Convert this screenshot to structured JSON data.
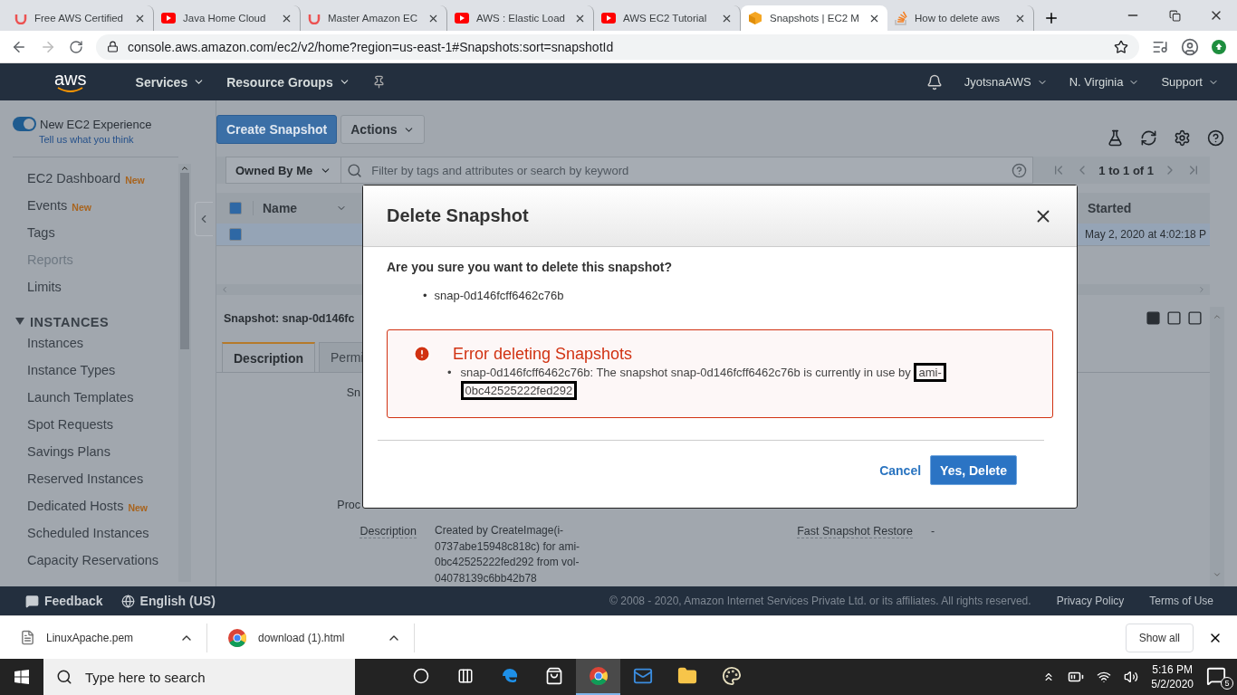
{
  "browser_tabs": [
    {
      "title": "Free AWS Certified",
      "kind": "udemy",
      "selected": false
    },
    {
      "title": "Java Home Cloud",
      "kind": "youtube",
      "selected": false
    },
    {
      "title": "Master Amazon EC",
      "kind": "udemy",
      "selected": false
    },
    {
      "title": "AWS : Elastic Load",
      "kind": "youtube",
      "selected": false
    },
    {
      "title": "AWS EC2 Tutorial",
      "kind": "youtube",
      "selected": false
    },
    {
      "title": "Snapshots | EC2 M",
      "kind": "box",
      "selected": true
    },
    {
      "title": "How to delete aws",
      "kind": "stack",
      "selected": false
    }
  ],
  "address": "console.aws.amazon.com/ec2/v2/home?region=us-east-1#Snapshots:sort=snapshotId",
  "header": {
    "logo": "aws",
    "menus": [
      "Services",
      "Resource Groups"
    ],
    "right_menus": [
      "JyotsnaAWS",
      "N. Virginia",
      "Support"
    ]
  },
  "sidebar": {
    "toggle": {
      "label": "New EC2 Experience",
      "link": "Tell us what you think",
      "on": true
    },
    "items": [
      {
        "label": "EC2 Dashboard",
        "badge": "New",
        "disabled": false
      },
      {
        "label": "Events",
        "badge": "New",
        "disabled": false
      },
      {
        "label": "Tags",
        "disabled": false
      },
      {
        "label": "Reports",
        "disabled": true
      },
      {
        "label": "Limits",
        "disabled": false
      }
    ],
    "sections": [
      {
        "title": "INSTANCES",
        "expanded": true,
        "items": [
          {
            "label": "Instances",
            "disabled": false
          },
          {
            "label": "Instance Types",
            "disabled": false
          },
          {
            "label": "Launch Templates",
            "disabled": false
          },
          {
            "label": "Spot Requests",
            "disabled": false
          },
          {
            "label": "Savings Plans",
            "disabled": false
          },
          {
            "label": "Reserved Instances",
            "disabled": false
          },
          {
            "label": "Dedicated Hosts",
            "badge": "New",
            "disabled": false
          },
          {
            "label": "Scheduled Instances",
            "disabled": false
          },
          {
            "label": "Capacity Reservations",
            "disabled": false
          }
        ]
      }
    ]
  },
  "toolbar": {
    "buttons": [
      {
        "label": "Create Snapshot",
        "kind": "primary"
      },
      {
        "label": "Actions",
        "kind": "dropdown"
      }
    ]
  },
  "filter": {
    "owner": "Owned By Me",
    "placeholder": "Filter by tags and attributes or search by keyword",
    "pagination": "1 to 1 of 1"
  },
  "table": {
    "all_selected": true,
    "columns": [
      {
        "label": "Name"
      },
      {
        "label": "Started"
      }
    ],
    "rows": [
      {
        "selected": true,
        "started": "May 2, 2020 at 4:02:18 P"
      }
    ]
  },
  "details": {
    "title": "Snapshot: snap-0d146fc",
    "tabs": [
      {
        "label": "Description",
        "selected": true
      },
      {
        "label": "Permi",
        "selected": false
      }
    ],
    "fields": [
      {
        "label": "Sn"
      },
      {
        "label": "Proc"
      },
      {
        "label": "Description",
        "value": "Created by CreateImage(i-0737abe15948c818c) for ami-0bc42525222fed292 from vol-04078139c6bb42b78",
        "right_label": "Fast Snapshot Restore",
        "right_value": "-"
      }
    ]
  },
  "dialog": {
    "title": "Delete Snapshot",
    "bullet": "•",
    "question": "Are you sure you want to delete this snapshot?",
    "items": [
      "snap-0d146fcff6462c76b"
    ],
    "error": {
      "title": "Error deleting Snapshots",
      "message": [
        {
          "text": "snap-0d146fcff6462c76b: The snapshot snap-0d146fcff6462c76b is currently in use by",
          "highlighted": false
        },
        {
          "text": "ami-",
          "highlighted": true
        },
        {
          "text": "0bc42525222fed292",
          "highlighted": true
        }
      ]
    },
    "buttons": [
      {
        "label": "Cancel",
        "kind": "link"
      },
      {
        "label": "Yes, Delete",
        "kind": "primary"
      }
    ]
  },
  "footer": {
    "left": [
      "Feedback",
      "English (US)"
    ],
    "copyright": "© 2008 - 2020, Amazon Internet Services Private Ltd. or its affiliates. All rights reserved.",
    "links": [
      "Privacy Policy",
      "Terms of Use"
    ]
  },
  "downloads": {
    "items": [
      {
        "name": "LinuxApache.pem",
        "kind": "file"
      },
      {
        "name": "download (1).html",
        "kind": "chrome"
      }
    ],
    "show_all": "Show all"
  },
  "taskbar": {
    "search_placeholder": "Type here to search",
    "apps": [
      {
        "kind": "cortana",
        "selected": false
      },
      {
        "kind": "taskview",
        "selected": false
      },
      {
        "kind": "edge",
        "selected": false
      },
      {
        "kind": "store",
        "selected": false
      },
      {
        "kind": "chrome",
        "selected": true
      },
      {
        "kind": "mail",
        "selected": false
      },
      {
        "kind": "explorer",
        "selected": false
      },
      {
        "kind": "paint",
        "selected": false
      }
    ],
    "time": "5:16 PM",
    "date": "5/2/2020",
    "notifications": "5"
  }
}
